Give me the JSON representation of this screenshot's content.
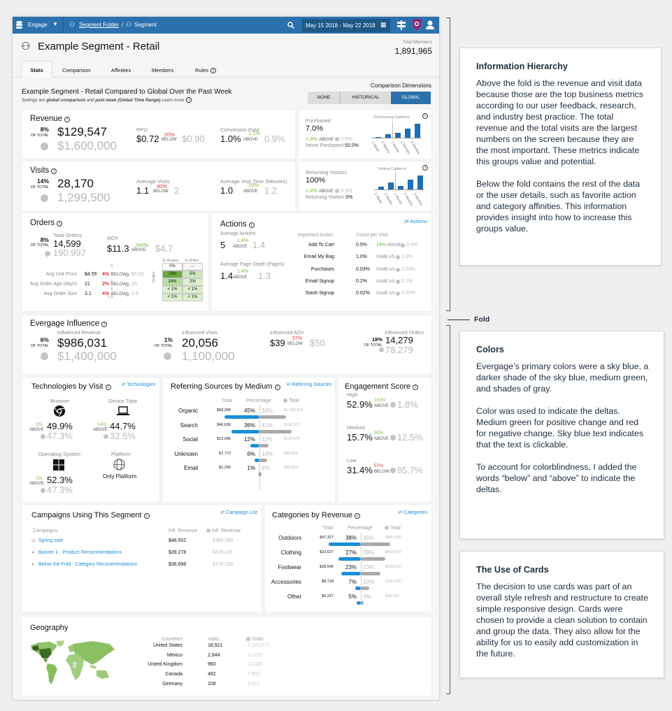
{
  "header": {
    "app": "Engage",
    "folder": "Segment Folder",
    "sep": "/",
    "segment": "Segment",
    "date_range": "May 15 2018 - May 22 2018",
    "brand_color": "#2b71ad"
  },
  "page": {
    "title": "Example Segment - Retail",
    "total_members_label": "Total Members",
    "total_members": "1,891,965"
  },
  "tabs": [
    {
      "label": "Stats",
      "active": true
    },
    {
      "label": "Comparison"
    },
    {
      "label": "Affinities"
    },
    {
      "label": "Members"
    },
    {
      "label": "Rules"
    }
  ],
  "comparison": {
    "heading": "Example Segment - Retail Compared to Global Over the Past Week",
    "s1": "Settings are ",
    "s2": "global comparison",
    "s3": " and ",
    "s4": "past week (Global Time Range)",
    "s5": " Learn more",
    "dims_label": "Comparison Dimensions",
    "options": [
      "NONE",
      "HISTORICAL",
      "GLOBAL"
    ],
    "selected": "GLOBAL"
  },
  "common": {
    "of_total": "OF TOTAL",
    "above": "ABOVE",
    "below": "BELOW",
    "same_as": "SAME AS"
  },
  "revenue": {
    "title": "Revenue",
    "pct": "8%",
    "value": "$129,547",
    "global": "$1,600,000",
    "m1": {
      "label": "RPU",
      "value": "$0.72",
      "delta": "20%",
      "dir": "BELOW",
      "compare": "$0.90"
    },
    "m2": {
      "label": "Conversion Rate",
      "value": "1.0%",
      "delta": "1.1%",
      "dir": "ABOVE",
      "compare": "0.9%"
    }
  },
  "purchased": {
    "label": "Purchased",
    "value": "7.0%",
    "delta": "1.4%",
    "dir": "ABOVE",
    "compare": "0.9%",
    "sub_label": "Never Purchased",
    "sub_value": "93.0%",
    "chart": {
      "title": "Purchasing Cadence",
      "categories": [
        "1 Week",
        "2 Weeks",
        "1 Month",
        "2 Months",
        "3 Months"
      ],
      "values": [
        1,
        5,
        7,
        13,
        20
      ]
    }
  },
  "visits": {
    "title": "Visits",
    "pct": "14%",
    "value": "28,170",
    "global": "1,299,500",
    "m1": {
      "label": "Average Visits",
      "value": "1.1",
      "delta": "90%",
      "dir": "BELOW",
      "compare": "2"
    },
    "m2": {
      "label": "Average Visit Time (Minutes)",
      "value": "1.0",
      "delta": "15%",
      "dir": "ABOVE",
      "compare": "1.2"
    }
  },
  "returning": {
    "label": "Returning Visitors",
    "value": "100%",
    "delta": "1.4%",
    "dir": "ABOVE",
    "compare": "0.9%",
    "sub_label": "Returning Visitors",
    "sub_value": "0%",
    "chart": {
      "title": "Visiting Cadence",
      "categories": [
        "1 Week",
        "2 Weeks",
        "1 Month",
        "2 Months",
        "3 Months"
      ],
      "values": [
        6,
        15,
        8,
        21,
        30
      ]
    }
  },
  "orders": {
    "title": "Orders",
    "pct": "8%",
    "total_label": "Total Orders",
    "value": "14,599",
    "global": "190,997",
    "aov": {
      "label": "AOV",
      "value": "$11.3",
      "delta": "240%",
      "dir": "ABOVE",
      "compare": "$4.7"
    },
    "rows": [
      {
        "label": "Avg Unit Price",
        "value": "$4.55",
        "delta": "4%",
        "dir": "BELOW",
        "compare": "$5.63"
      },
      {
        "label": "Avg Order Age (days)",
        "value": "21",
        "delta": "2%",
        "dir": "BELOW",
        "compare": "25"
      },
      {
        "label": "Avg Order Size",
        "value": "3.1",
        "delta": "4%",
        "dir": "BELOW",
        "compare": "3.9"
      }
    ],
    "grid": {
      "axis": "Orders",
      "cols": [
        "% of users",
        "% of Rev"
      ],
      "rows": [
        {
          "k": "0",
          "u": "0%",
          "r": "--"
        },
        {
          "k": "1",
          "u": "73%",
          "r": "5%"
        },
        {
          "k": "2",
          "u": "24%",
          "r": "2%"
        },
        {
          "k": "3",
          "u": "< 1%",
          "r": "< 1%"
        },
        {
          "k": "> 3",
          "u": "< 1%",
          "r": "< 1%"
        }
      ]
    }
  },
  "actions": {
    "title": "Actions",
    "link": "Actions",
    "m1": {
      "label": "Average Actions",
      "value": "5",
      "delta": "1.4%",
      "dir": "ABOVE",
      "compare": "1.4"
    },
    "m2": {
      "label": "Average Page Depth (Pages)",
      "value": "1.4",
      "delta": "1.4%",
      "dir": "ABOVE",
      "compare": "1.3"
    },
    "col1": "Important Action",
    "col2": "Count per Visit",
    "rows": [
      {
        "name": "Add To Cart",
        "count": "0.5%",
        "delta": "14%",
        "dir": "ABOVE",
        "compare": "0.3%"
      },
      {
        "name": "Email My Bag",
        "count": "1.0%",
        "delta": "",
        "dir": "SAME AS",
        "compare": "1.0%"
      },
      {
        "name": "Purchases",
        "count": "0.03%",
        "delta": "",
        "dir": "SAME AS",
        "compare": "0.03%"
      },
      {
        "name": "Email Signup",
        "count": "0.2%",
        "delta": "",
        "dir": "SAME AS",
        "compare": "0.2%"
      },
      {
        "name": "Stash Signup",
        "count": "0.02%",
        "delta": "",
        "dir": "SAME AS",
        "compare": "0.02%"
      }
    ]
  },
  "influence": {
    "title": "Evergage Influence",
    "revenue": {
      "label": "Influenced Revenue",
      "pct": "6%",
      "value": "$986,031",
      "global": "$1,400,000"
    },
    "visits": {
      "label": "Influenced Visits",
      "pct": "1%",
      "value": "20,056",
      "global": "1,100,000"
    },
    "aov": {
      "label": "Influenced AOV",
      "value": "$39",
      "delta": "57%",
      "dir": "BELOW",
      "compare": "$50"
    },
    "orders": {
      "label": "Influenced Orders",
      "pct": "18%",
      "value": "14,279",
      "global": "78,279"
    }
  },
  "tech": {
    "title": "Technologies by Visit",
    "link": "Technologies",
    "browser": {
      "label": "Browser",
      "delta": "2%",
      "dir": "ABOVE",
      "value": "49.9%",
      "global": "47.3%"
    },
    "device": {
      "label": "Device Type",
      "delta": "14%",
      "dir": "ABOVE",
      "value": "44.7%",
      "global": "32.5%"
    },
    "os": {
      "label": "Operating System",
      "delta": "2%",
      "dir": "ABOVE",
      "value": "52.3%",
      "global": "47.3%"
    },
    "platform": {
      "label": "Platform",
      "value": "Only Platform"
    }
  },
  "referring": {
    "title": "Referring Sources by Medium",
    "link": "Referring Sources",
    "h_total": "Total",
    "h_pct": "Percentage",
    "h_gtotal": "Total",
    "rows": [
      {
        "label": "Organic",
        "total": "$58,296",
        "pct": 45,
        "gpct": 34,
        "gtotal": "$1,026,800"
      },
      {
        "label": "Search",
        "total": "$46,636",
        "pct": 36,
        "gpct": 41,
        "gtotal": "$138,117"
      },
      {
        "label": "Social",
        "total": "$15,545",
        "pct": 12,
        "gpct": 12,
        "gtotal": "$116,075"
      },
      {
        "label": "Unknown",
        "total": "$7,773",
        "pct": 6,
        "gpct": 10,
        "gtotal": "$46,806"
      },
      {
        "label": "Email",
        "total": "$1,295",
        "pct": 1,
        "gpct": 3,
        "gtotal": "$46,860"
      }
    ]
  },
  "engagement": {
    "title": "Engagement Score",
    "rows": [
      {
        "label": "High",
        "value": "52.9%",
        "delta": "100%",
        "dir": "ABOVE",
        "compare": "1.8%"
      },
      {
        "label": "Medium",
        "value": "15.7%",
        "delta": "30%",
        "dir": "ABOVE",
        "compare": "12.5%"
      },
      {
        "label": "Low",
        "value": "31.4%",
        "delta": "57%",
        "dir": "BELOW",
        "compare": "85.7%"
      }
    ]
  },
  "campaigns": {
    "title": "Campaigns Using This Segment",
    "link": "Campaign List",
    "h_name": "Campaigns",
    "h_rev": "Infl. Revenue",
    "h_grev": "Infl. Revenue",
    "rows": [
      {
        "name": "Spring sale",
        "icon": "mail-icon",
        "rev": "$48,502",
        "grev": "$356,099"
      },
      {
        "name": "Banner 1 - Product Recommendations",
        "icon": "globe-icon",
        "rev": "$39,278",
        "grev": "$470,241"
      },
      {
        "name": "Below the Fold - Category Recommendations",
        "icon": "globe-icon",
        "rev": "$36,698",
        "grev": "$170,258"
      }
    ]
  },
  "categories": {
    "title": "Categories by Revenue",
    "link": "Categories",
    "h_total": "Total",
    "h_pct": "Percentage",
    "h_gtotal": "Total",
    "rows": [
      {
        "label": "Outdoors",
        "total": "$47,327",
        "pct": 38,
        "gpct": 35,
        "gtotal": "$560,000"
      },
      {
        "label": "Clothing",
        "total": "$33,627",
        "pct": 27,
        "gpct": 29,
        "gtotal": "$464,000"
      },
      {
        "label": "Footwear",
        "total": "$28,645",
        "pct": 23,
        "gpct": 23,
        "gtotal": "$368,000"
      },
      {
        "label": "Accessories",
        "total": "$8,718",
        "pct": 7,
        "gpct": 10,
        "gtotal": "$160,000"
      },
      {
        "label": "Other",
        "total": "$6,227",
        "pct": 5,
        "gpct": 3,
        "gtotal": "$48,000"
      }
    ]
  },
  "geography": {
    "title": "Geography",
    "h_country": "Countries",
    "h_visits": "Visits",
    "h_gvisits": "Visits",
    "rows": [
      {
        "country": "United States",
        "visits": "18,921",
        "gvisits": "3,109,577"
      },
      {
        "country": "Mexico",
        "visits": "2,844",
        "gvisits": "21,055"
      },
      {
        "country": "United Kingdom",
        "visits": "960",
        "gvisits": "10,308"
      },
      {
        "country": "Canada",
        "visits": "482",
        "gvisits": "7,852"
      },
      {
        "country": "Germany",
        "visits": "108",
        "gvisits": "5,421"
      }
    ]
  },
  "annotations": {
    "fold": "Fold",
    "cards": [
      {
        "title": "Information Hierarchy",
        "paras": [
          "Above the fold is the revenue and visit data because those are the top business metrics according to our user feedback, research, and industry best practice. The total revenue and the total visits are the largest numbers on the screen because they are the most important. These metrics indicate this groups value and potential.",
          "Below the fold contains the rest of the data or the user details, such as favorite action and category affinities. This information provides insight into how to increase this groups value."
        ]
      },
      {
        "title": "Colors",
        "paras": [
          "Evergage’s primary colors were a sky blue, a darker shade of the sky blue, medium green, and shades of gray.",
          "Color was used to indicate the deltas. Medium green for positive change and red for negative change. Sky blue text indicates that the text is clickable.",
          "To account for colorblindness, I added the words “below” and “above” to indicate the deltas."
        ]
      },
      {
        "title": "The Use of Cards",
        "paras": [
          "The decision to use cards was part of an overall style refresh and restructure to create simple responsive design. Cards were chosen to provide a clean solution to contain and group the data. They also allow for the ability for us to easily add customization in the future."
        ]
      }
    ]
  }
}
